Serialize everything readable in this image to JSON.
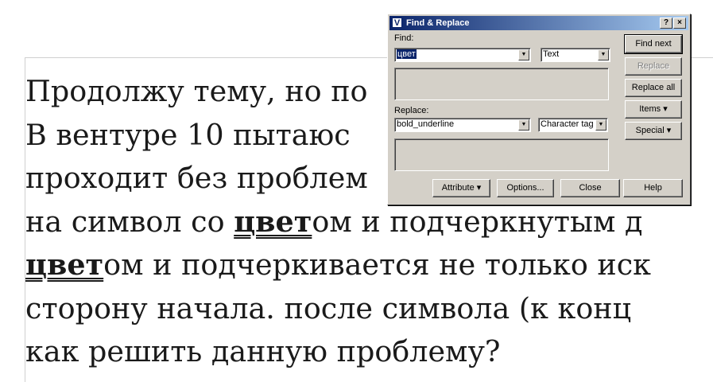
{
  "document": {
    "lines": [
      "Продолжу тему, но по",
      "В вентуре 10 пытаюс",
      "проходит без проблем",
      [
        "на символ со ",
        "цвет",
        "ом и подчеркнутым д"
      ],
      [
        "",
        "цвет",
        "ом и подчеркивается не только иск"
      ],
      "сторону начала. после символа (к конц",
      "как решить данную проблему?"
    ]
  },
  "dialog": {
    "title": "Find & Replace",
    "app_icon": "V",
    "help_glyph": "?",
    "close_glyph": "×",
    "find_label": "Find:",
    "find_value": "цвет",
    "find_type": "Text",
    "replace_label": "Replace:",
    "replace_value": "bold_underline",
    "replace_type": "Character tag",
    "buttons": {
      "find_next": "Find next",
      "replace": "Replace",
      "replace_all": "Replace all",
      "items": "Items",
      "special": "Special",
      "attribute": "Attribute",
      "options": "Options...",
      "close": "Close",
      "help": "Help"
    }
  }
}
